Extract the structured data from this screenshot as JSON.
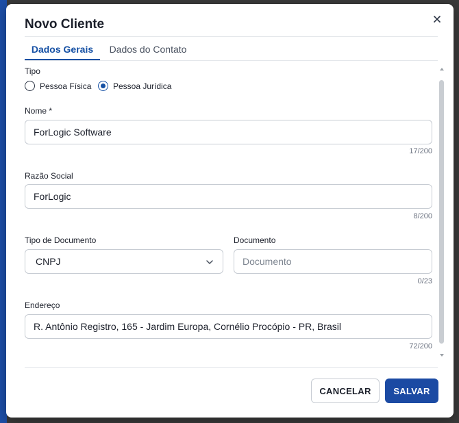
{
  "dialog": {
    "title": "Novo Cliente",
    "close_icon": "close-icon",
    "tabs": [
      {
        "label": "Dados Gerais",
        "active": true
      },
      {
        "label": "Dados do Contato",
        "active": false
      }
    ]
  },
  "form": {
    "tipo": {
      "label": "Tipo",
      "options": [
        {
          "label": "Pessoa Física",
          "selected": false
        },
        {
          "label": "Pessoa Jurídica",
          "selected": true
        }
      ]
    },
    "nome": {
      "label": "Nome *",
      "value": "ForLogic Software",
      "counter": "17/200"
    },
    "razao_social": {
      "label": "Razão Social",
      "value": "ForLogic",
      "counter": "8/200"
    },
    "tipo_documento": {
      "label": "Tipo de Documento",
      "value": "CNPJ",
      "icon": "chevron-down-icon"
    },
    "documento": {
      "label": "Documento",
      "value": "",
      "placeholder": "Documento",
      "counter": "0/23"
    },
    "endereco": {
      "label": "Endereço",
      "value": "R. Antônio Registro, 165 - Jardim Europa, Cornélio Procópio - PR, Brasil",
      "counter": "72/200"
    }
  },
  "footer": {
    "cancel_label": "CANCELAR",
    "save_label": "SALVAR"
  },
  "colors": {
    "primary": "#1b4aa3",
    "tab_active": "#1550a4",
    "border": "#c7ccd3"
  }
}
